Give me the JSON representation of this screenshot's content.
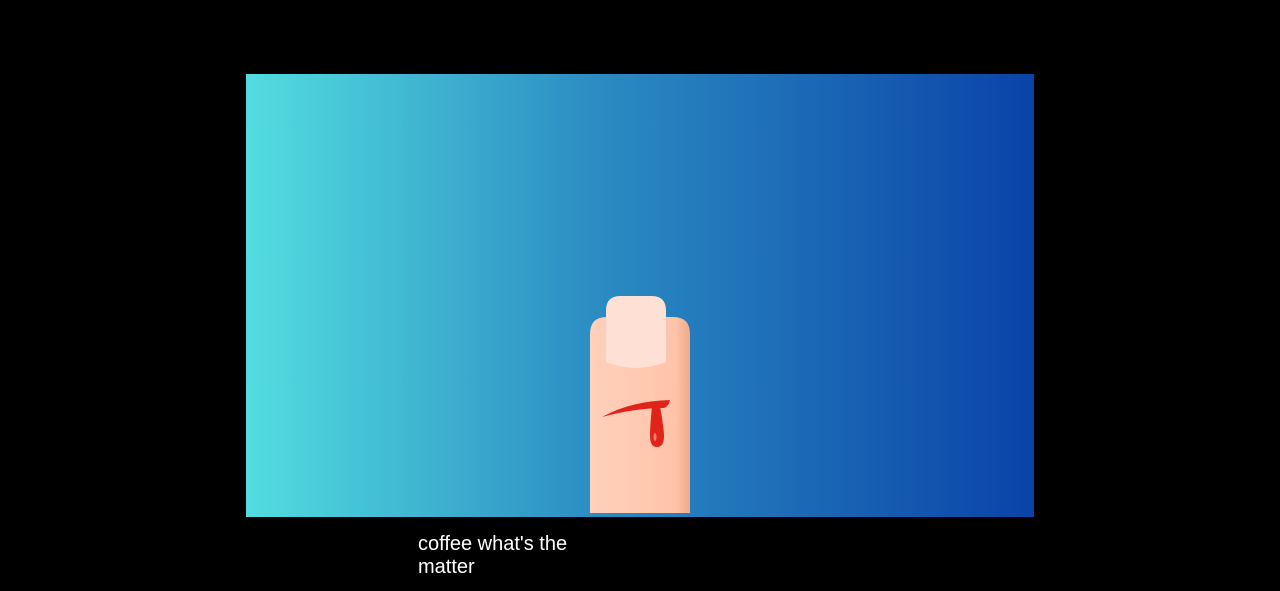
{
  "video": {
    "background_colors": {
      "left": "#52dde0",
      "mid": "#2b8bc2",
      "right": "#0a43a8"
    },
    "illustration": {
      "subject": "finger-with-cut",
      "skin_color": "#ffcab2",
      "nail_color": "#ffe0d4",
      "blood_color": "#e0241a"
    }
  },
  "captions": {
    "line1": "coffee what's the",
    "line2": "matter"
  }
}
